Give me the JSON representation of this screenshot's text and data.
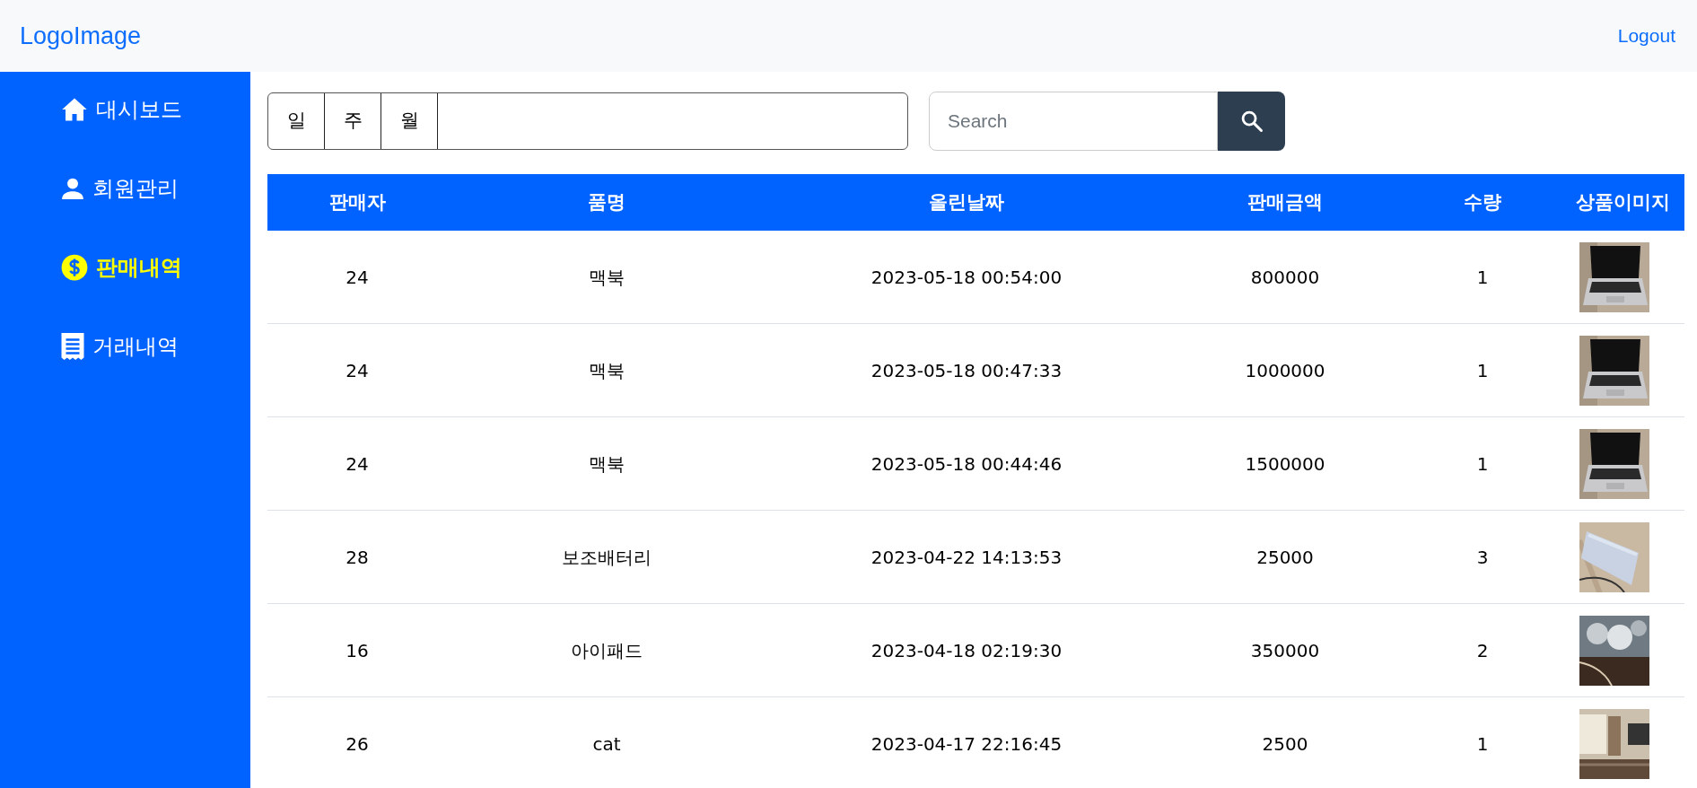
{
  "header": {
    "logo": "LogoImage",
    "logout": "Logout"
  },
  "sidebar": {
    "items": [
      {
        "label": "대시보드",
        "kind": "home",
        "selected": false
      },
      {
        "label": "회원관리",
        "kind": "person",
        "selected": false
      },
      {
        "label": "판매내역",
        "kind": "dollar",
        "selected": true
      },
      {
        "label": "거래내역",
        "kind": "receipt",
        "selected": false
      }
    ]
  },
  "period_buttons": [
    "일",
    "주",
    "월"
  ],
  "search": {
    "placeholder": "Search"
  },
  "table": {
    "columns": [
      "판매자",
      "품명",
      "올린날짜",
      "판매금액",
      "수량",
      "상품이미지"
    ],
    "rows": [
      {
        "seller": "24",
        "item": "맥북",
        "date": "2023-05-18 00:54:00",
        "price": "800000",
        "qty": "1"
      },
      {
        "seller": "24",
        "item": "맥북",
        "date": "2023-05-18 00:47:33",
        "price": "1000000",
        "qty": "1"
      },
      {
        "seller": "24",
        "item": "맥북",
        "date": "2023-05-18 00:44:46",
        "price": "1500000",
        "qty": "1"
      },
      {
        "seller": "28",
        "item": "보조배터리",
        "date": "2023-04-22 14:13:53",
        "price": "25000",
        "qty": "3"
      },
      {
        "seller": "16",
        "item": "아이패드",
        "date": "2023-04-18 02:19:30",
        "price": "350000",
        "qty": "2"
      },
      {
        "seller": "26",
        "item": "cat",
        "date": "2023-04-17 22:16:45",
        "price": "2500",
        "qty": "1"
      }
    ]
  }
}
